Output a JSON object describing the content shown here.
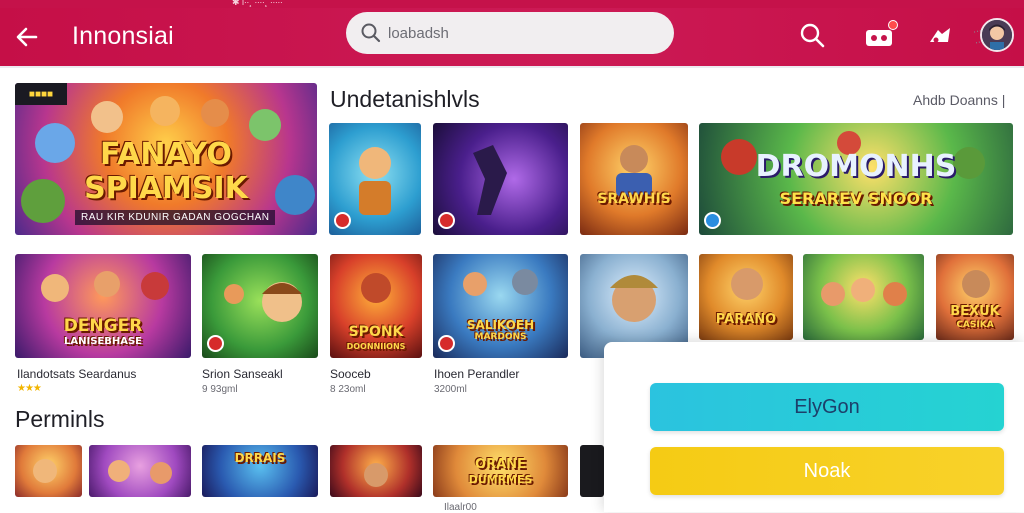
{
  "statusbar": {
    "text": "✱ l∙∙¸ ∙∙∙∙¸ ∙∙∙∙∙"
  },
  "header": {
    "title": "Innonsiai",
    "search_placeholder": "loabadsh",
    "search_hint": "·∙∙ ∙∙"
  },
  "sections": {
    "featured": {
      "title": "Undetanishlvls",
      "see_all": "Ahdb Doanns |"
    },
    "popular": {
      "title": "Perminls"
    }
  },
  "hero": {
    "tag": "■■■■",
    "title_line1": "FANAYO",
    "title_line2": "SPIAMSIK",
    "subtitle": "RAU KIR KDUNIR GADAN GOGCHAN"
  },
  "row1_tiles": [
    {
      "label": ""
    },
    {
      "label": ""
    },
    {
      "label": ""
    },
    {
      "label": "SRAWHIS"
    },
    {
      "label": "DROMONHS",
      "sub": "SERAREV SNOOR"
    }
  ],
  "row2_tiles": [
    {
      "label": "DENGER",
      "sub": "LANISEBHASE"
    },
    {
      "label": ""
    },
    {
      "label": "SPONK",
      "sub": "DOONNIIONS"
    },
    {
      "label": "SALIKOEH",
      "sub": "MARDONS"
    },
    {
      "label": ""
    },
    {
      "label": "PARANO"
    },
    {
      "label": ""
    },
    {
      "label": "BEXUK",
      "sub": "CASIKA"
    }
  ],
  "captions": [
    {
      "title": "Ilandotsats Seardanus",
      "stars": "★★★"
    },
    {
      "title": "Srion Sanseakl",
      "sub": "9 93gml"
    },
    {
      "title": "Sooceb",
      "sub": "8 23oml"
    },
    {
      "title": "Ihoen Perandler",
      "sub": "3200ml"
    }
  ],
  "row3_tiles": [
    {
      "label": ""
    },
    {
      "label": ""
    },
    {
      "label": "DRRAIS"
    },
    {
      "label": ""
    },
    {
      "label": "ORANE",
      "sub": "DUMRMES"
    },
    {
      "label": ""
    }
  ],
  "row3_caption": "Ilaalr00",
  "panel": {
    "primary": "ElyGon",
    "secondary": "Noak"
  },
  "colors": {
    "brand": "#c5124a",
    "primary_button": "#29c9dd",
    "secondary_button": "#f6cd1d"
  },
  "icons": [
    "back-arrow-icon",
    "search-icon",
    "gift-icon",
    "game-controller-icon",
    "avatar"
  ]
}
